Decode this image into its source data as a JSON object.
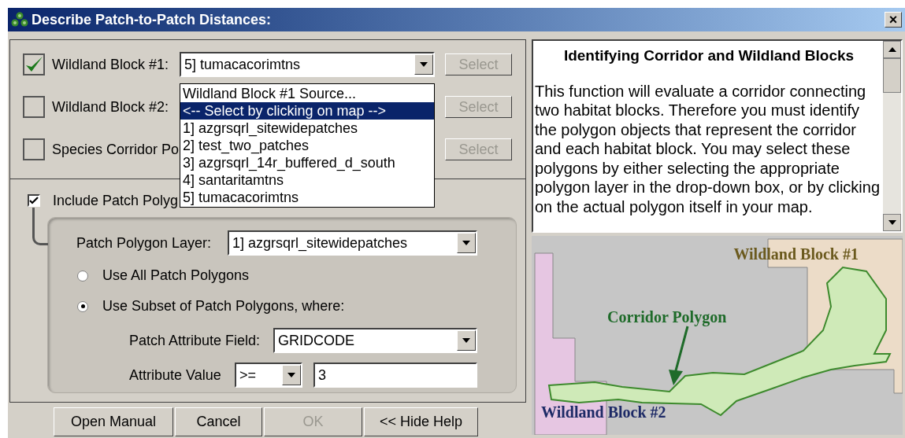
{
  "window": {
    "title": "Describe Patch-to-Patch Distances:",
    "close": "×"
  },
  "blocks": [
    {
      "label": "Wildland Block #1:",
      "checked": true,
      "value": "5] tumacacorimtns",
      "select_button": {
        "label": "Select",
        "disabled": true
      }
    },
    {
      "label": "Wildland Block #2:",
      "checked": false,
      "select_button": {
        "label": "Select",
        "disabled": true
      }
    },
    {
      "label": "Species Corridor Po",
      "checked": false,
      "select_button": {
        "label": "Select",
        "disabled": true
      }
    }
  ],
  "dropdown": {
    "items": [
      {
        "label": "Wildland Block #1 Source...",
        "selected": false
      },
      {
        "label": "<-- Select by clicking on map -->",
        "selected": true
      },
      {
        "label": "1] azgrsqrl_sitewidepatches",
        "selected": false
      },
      {
        "label": "2] test_two_patches",
        "selected": false
      },
      {
        "label": "3] azgrsqrl_14r_buffered_d_south",
        "selected": false
      },
      {
        "label": "4] santaritamtns",
        "selected": false
      },
      {
        "label": "5] tumacacorimtns",
        "selected": false
      }
    ]
  },
  "patch": {
    "include": {
      "label": "Include Patch Polyg",
      "checked": true
    },
    "layer": {
      "label": "Patch Polygon Layer:",
      "value": "1] azgrsqrl_sitewidepatches"
    },
    "radios": [
      {
        "label": "Use All Patch Polygons",
        "selected": false
      },
      {
        "label": "Use Subset of Patch Polygons, where:",
        "selected": true
      }
    ],
    "attribute_field": {
      "label": "Patch Attribute Field:",
      "value": "GRIDCODE"
    },
    "attribute_value": {
      "label": "Attribute Value",
      "operator": ">=",
      "value": "3"
    }
  },
  "buttons": [
    {
      "label": "Open Manual",
      "disabled": false
    },
    {
      "label": "Cancel",
      "disabled": false
    },
    {
      "label": "OK",
      "disabled": true
    },
    {
      "label": "<< Hide Help",
      "disabled": false
    }
  ],
  "help": {
    "heading": "Identifying Corridor and Wildland Blocks",
    "body": "This function will evaluate a corridor connecting two habitat blocks.  Therefore you must identify the polygon objects that represent the corridor and each habitat block.  You may select these polygons by either selecting the appropriate polygon layer in the drop-down box, or by clicking on the actual polygon itself in your map."
  },
  "map": {
    "labels": [
      {
        "kind": "block1",
        "text": "Wildland Block #1"
      },
      {
        "kind": "corridor",
        "text": "Corridor Polygon"
      },
      {
        "kind": "block2",
        "text": "Wildland Block #2"
      }
    ]
  }
}
